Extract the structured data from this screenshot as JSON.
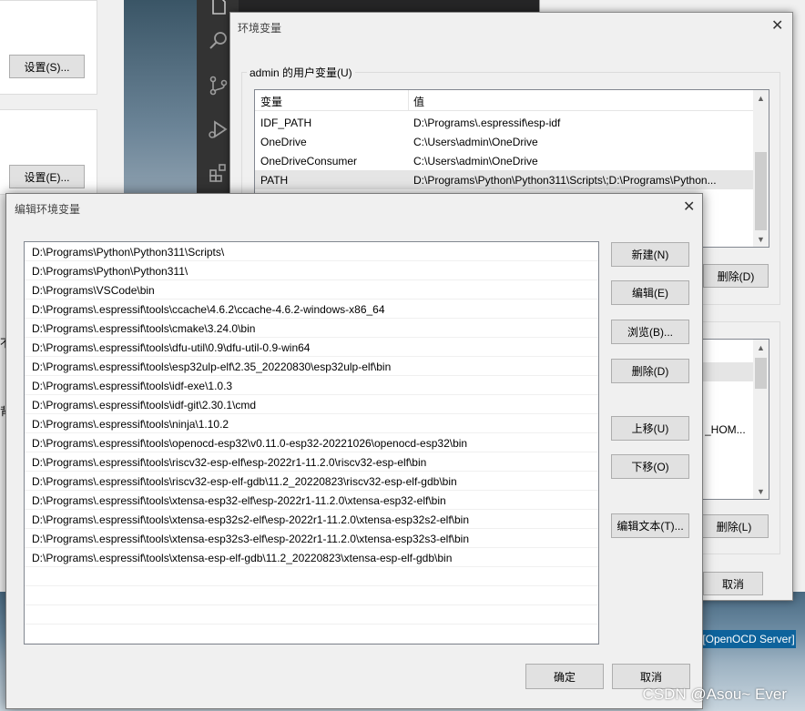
{
  "background": {
    "settings_s_button": "设置(S)...",
    "settings_e_button": "设置(E)...",
    "openocd_status": "[OpenOCD Server]",
    "watermark": "CSDN @Asou~ Ever",
    "left_fragments": [
      "不",
      "背"
    ]
  },
  "env_window": {
    "title": "环境变量",
    "user_group_label": "admin 的用户变量(U)",
    "columns": [
      "变量",
      "值"
    ],
    "rows": [
      {
        "name": "IDF_PATH",
        "value": "D:\\Programs\\.espressif\\esp-idf"
      },
      {
        "name": "OneDrive",
        "value": "C:\\Users\\admin\\OneDrive"
      },
      {
        "name": "OneDriveConsumer",
        "value": "C:\\Users\\admin\\OneDrive"
      },
      {
        "name": "PATH",
        "value": "D:\\Programs\\Python\\Python311\\Scripts\\;D:\\Programs\\Python..."
      }
    ],
    "user_delete_button": "删除(D)",
    "system_partial_value": "_HOM...",
    "system_delete_button": "删除(L)",
    "cancel_button": "取消"
  },
  "edit_dialog": {
    "title": "编辑环境变量",
    "paths": [
      "D:\\Programs\\Python\\Python311\\Scripts\\",
      "D:\\Programs\\Python\\Python311\\",
      "D:\\Programs\\VSCode\\bin",
      "D:\\Programs\\.espressif\\tools\\ccache\\4.6.2\\ccache-4.6.2-windows-x86_64",
      "D:\\Programs\\.espressif\\tools\\cmake\\3.24.0\\bin",
      "D:\\Programs\\.espressif\\tools\\dfu-util\\0.9\\dfu-util-0.9-win64",
      "D:\\Programs\\.espressif\\tools\\esp32ulp-elf\\2.35_20220830\\esp32ulp-elf\\bin",
      "D:\\Programs\\.espressif\\tools\\idf-exe\\1.0.3",
      "D:\\Programs\\.espressif\\tools\\idf-git\\2.30.1\\cmd",
      "D:\\Programs\\.espressif\\tools\\ninja\\1.10.2",
      "D:\\Programs\\.espressif\\tools\\openocd-esp32\\v0.11.0-esp32-20221026\\openocd-esp32\\bin",
      "D:\\Programs\\.espressif\\tools\\riscv32-esp-elf\\esp-2022r1-11.2.0\\riscv32-esp-elf\\bin",
      "D:\\Programs\\.espressif\\tools\\riscv32-esp-elf-gdb\\11.2_20220823\\riscv32-esp-elf-gdb\\bin",
      "D:\\Programs\\.espressif\\tools\\xtensa-esp32-elf\\esp-2022r1-11.2.0\\xtensa-esp32-elf\\bin",
      "D:\\Programs\\.espressif\\tools\\xtensa-esp32s2-elf\\esp-2022r1-11.2.0\\xtensa-esp32s2-elf\\bin",
      "D:\\Programs\\.espressif\\tools\\xtensa-esp32s3-elf\\esp-2022r1-11.2.0\\xtensa-esp32s3-elf\\bin",
      "D:\\Programs\\.espressif\\tools\\xtensa-esp-elf-gdb\\11.2_20220823\\xtensa-esp-elf-gdb\\bin"
    ],
    "buttons": {
      "new": "新建(N)",
      "edit": "编辑(E)",
      "browse": "浏览(B)...",
      "delete": "删除(D)",
      "move_up": "上移(U)",
      "move_down": "下移(O)",
      "edit_text": "编辑文本(T)...",
      "ok": "确定",
      "cancel": "取消"
    }
  }
}
